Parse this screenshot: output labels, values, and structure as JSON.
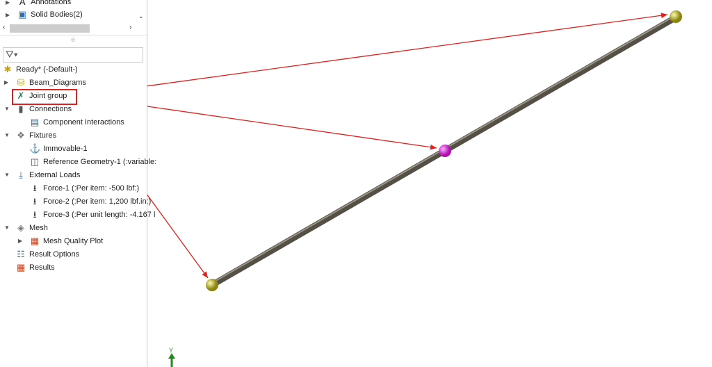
{
  "tree_top": [
    {
      "label": "Annotations",
      "icon": "annotations-icon"
    },
    {
      "label": "Solid Bodies(2)",
      "icon": "solid-bodies-icon"
    }
  ],
  "study": {
    "label": "Ready* (-Default-)"
  },
  "items": [
    {
      "label": "Beam_Diagrams",
      "icon": "beam-diagrams-icon",
      "level": 1,
      "expander": "collapsed"
    },
    {
      "label": "Joint group",
      "icon": "joint-group-icon",
      "level": 1,
      "expander": "none",
      "highlighted": true
    },
    {
      "label": "Connections",
      "icon": "connections-icon",
      "level": 1,
      "expander": "expanded"
    },
    {
      "label": "Component Interactions",
      "icon": "component-interactions-icon",
      "level": 2,
      "expander": "none"
    },
    {
      "label": "Fixtures",
      "icon": "fixtures-icon",
      "level": 1,
      "expander": "expanded"
    },
    {
      "label": "Immovable-1",
      "icon": "immovable-icon",
      "level": 2,
      "expander": "none"
    },
    {
      "label": "Reference Geometry-1 (:variable:",
      "icon": "reference-geometry-icon",
      "level": 2,
      "expander": "none"
    },
    {
      "label": "External Loads",
      "icon": "external-loads-icon",
      "level": 1,
      "expander": "expanded"
    },
    {
      "label": "Force-1 (:Per item: -500 lbf:)",
      "icon": "force-arrow-icon",
      "level": 2,
      "expander": "none"
    },
    {
      "label": "Force-2 (:Per item: 1,200 lbf.in:)",
      "icon": "force-arrow-icon",
      "level": 2,
      "expander": "none"
    },
    {
      "label": "Force-3 (:Per unit length: -4.167 l",
      "icon": "force-arrow-icon",
      "level": 2,
      "expander": "none"
    },
    {
      "label": "Mesh",
      "icon": "mesh-icon",
      "level": 1,
      "expander": "expanded"
    },
    {
      "label": "Mesh Quality Plot",
      "icon": "plot-icon",
      "level": 2,
      "expander": "collapsed"
    },
    {
      "label": "Result Options",
      "icon": "result-options-icon",
      "level": 1,
      "expander": "none"
    },
    {
      "label": "Results",
      "icon": "results-icon",
      "level": 1,
      "expander": "none"
    }
  ],
  "triad_label": "Y",
  "colors": {
    "highlight": "#e0201c",
    "joint": "#c9c21a",
    "mid_joint": "#e020e0",
    "beam": "#6e6a5e",
    "triad": "#1f8a1f"
  }
}
